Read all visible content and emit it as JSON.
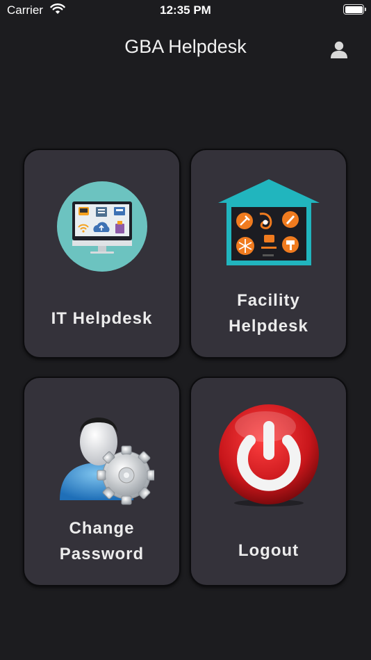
{
  "status_bar": {
    "carrier": "Carrier",
    "time": "12:35 PM"
  },
  "header": {
    "title": "GBA Helpdesk",
    "profile_icon": "person-icon"
  },
  "menu": {
    "it_helpdesk": {
      "label": "IT Helpdesk",
      "icon": "computer-services-icon"
    },
    "facility_helpdesk": {
      "line1": "Facility",
      "line2": "Helpdesk",
      "icon": "house-tools-icon"
    },
    "change_password": {
      "line1": "Change",
      "line2": "Password",
      "icon": "user-gear-icon"
    },
    "logout": {
      "label": "Logout",
      "icon": "power-button-icon"
    }
  },
  "colors": {
    "background": "#1c1c1f",
    "card": "#34323a",
    "teal": "#21b5be",
    "orange": "#f07b1f",
    "red": "#d42125"
  }
}
